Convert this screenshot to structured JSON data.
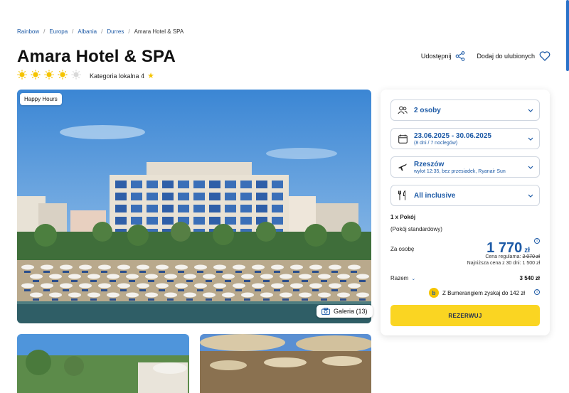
{
  "breadcrumb": [
    "Rainbow",
    "Europa",
    "Albania",
    "Durres",
    "Amara Hotel & SPA"
  ],
  "hotel": {
    "name": "Amara Hotel & SPA",
    "rating_suns": 4,
    "rating_max": 5,
    "local_category": "Kategoria lokalna 4"
  },
  "actions": {
    "share_label": "Udostępnij",
    "favorite_label": "Dodaj do ulubionych"
  },
  "photo": {
    "badge": "Happy Hours",
    "gallery_label": "Galeria (13)"
  },
  "booking": {
    "persons": "2 osoby",
    "dates": "23.06.2025 - 30.06.2025",
    "dates_sub": "(8 dni / 7 noclegów)",
    "departure": "Rzeszów",
    "departure_sub": "wylot 12:35, bez przesiadek, Ryanair Sun",
    "board": "All inclusive",
    "rooms": "1 x Pokój",
    "room_type": "(Pokój standardowy)",
    "per_person_label": "Za osobę",
    "price": "1 770",
    "currency": "zł",
    "regular_label": "Cena regularna:",
    "regular_price": "2 070 zł",
    "lowest_label": "Najniższa cena z 30 dni: 1 500 zł",
    "total_label": "Razem",
    "total_value": "3 540 zł",
    "bumerang": "Z Bumerangiem zyskaj do 142 zł",
    "book_label": "REZERWUJ"
  },
  "colors": {
    "brand_blue": "#1d5aa6",
    "cta_yellow": "#fad522",
    "sun_yellow": "#f5c400"
  }
}
